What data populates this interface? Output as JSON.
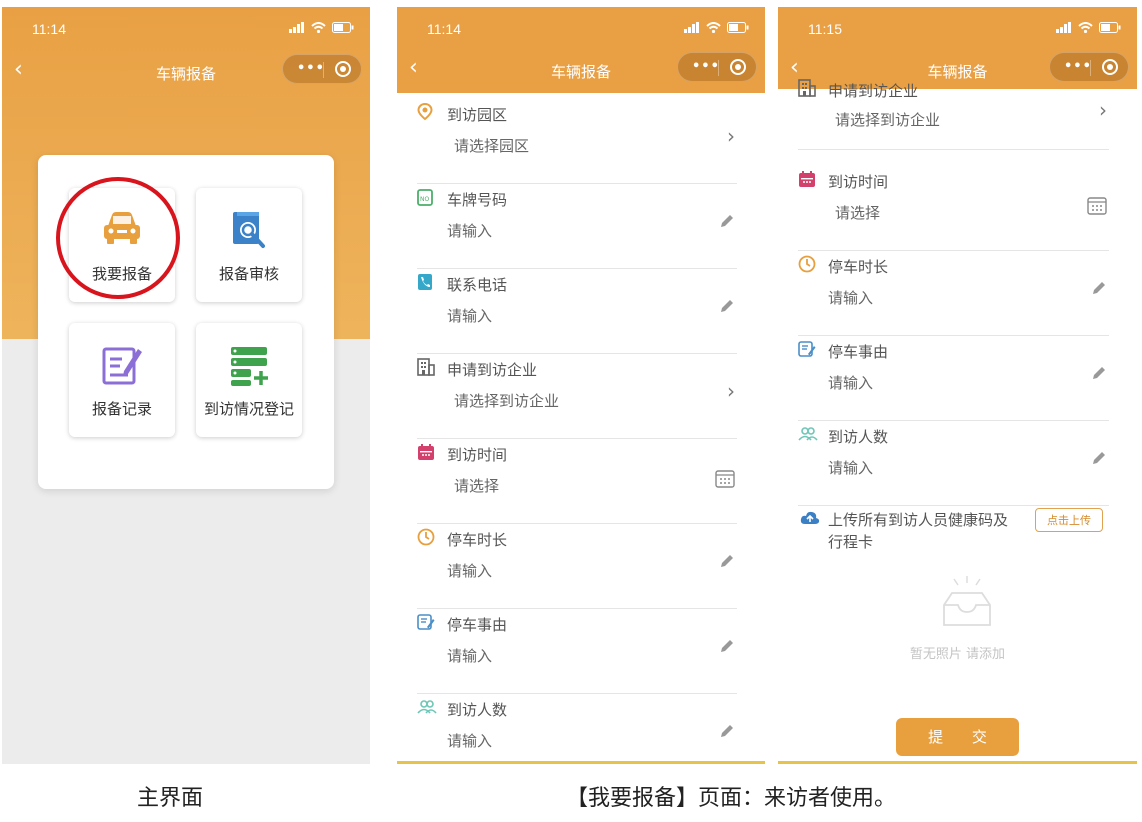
{
  "status": {
    "time1": "11:14",
    "time2": "11:14",
    "time3": "11:15"
  },
  "nav": {
    "title": "车辆报备",
    "back": "‹",
    "dots": "•••"
  },
  "home": {
    "tiles": [
      {
        "label": "我要报备",
        "icon": "car-icon"
      },
      {
        "label": "报备审核",
        "icon": "document-search-icon"
      },
      {
        "label": "报备记录",
        "icon": "edit-record-icon"
      },
      {
        "label": "到访情况登记",
        "icon": "list-add-icon"
      }
    ]
  },
  "form": {
    "fields": [
      {
        "label": "到访园区",
        "value": "请选择园区",
        "icon": "location-pin-icon",
        "action": "chevron-right-icon"
      },
      {
        "label": "车牌号码",
        "value": "请输入",
        "icon": "plate-icon",
        "action": "pencil-icon"
      },
      {
        "label": "联系电话",
        "value": "请输入",
        "icon": "phone-icon",
        "action": "pencil-icon"
      },
      {
        "label": "申请到访企业",
        "value": "请选择到访企业",
        "icon": "building-icon",
        "action": "chevron-right-icon"
      },
      {
        "label": "到访时间",
        "value": "请选择",
        "icon": "calendar-icon",
        "action": "calendar-icon"
      },
      {
        "label": "停车时长",
        "value": "请输入",
        "icon": "clock-icon",
        "action": "pencil-icon"
      },
      {
        "label": "停车事由",
        "value": "请输入",
        "icon": "note-icon",
        "action": "pencil-icon"
      },
      {
        "label": "到访人数",
        "value": "请输入",
        "icon": "people-icon",
        "action": "pencil-icon"
      }
    ],
    "upload_label_line1": "上传所有到访人员健康码及",
    "upload_label_line2": "行程卡",
    "upload_button": "点击上传",
    "empty_text": "暂无照片 请添加",
    "submit": "提 交"
  },
  "captions": {
    "left": "主界面",
    "right": "【我要报备】页面：来访者使用。"
  },
  "colors": {
    "primary": "#e8a03e",
    "highlight": "#d8141d"
  }
}
